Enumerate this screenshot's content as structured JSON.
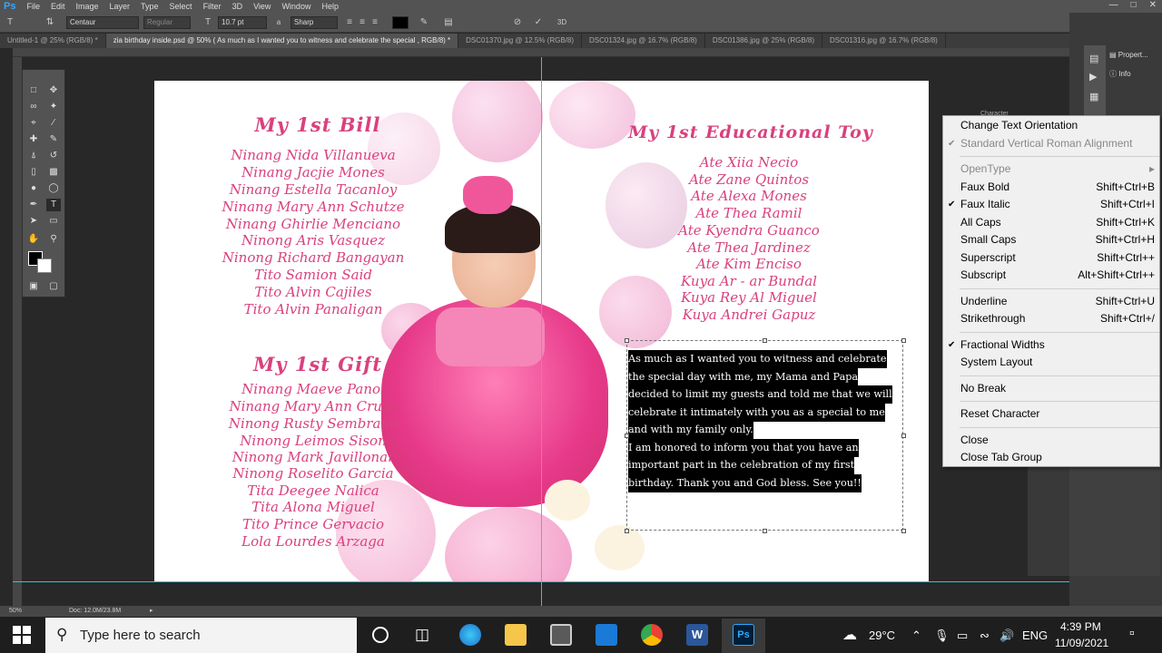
{
  "app": {
    "logo": "Ps",
    "menu": [
      "File",
      "Edit",
      "Image",
      "Layer",
      "Type",
      "Select",
      "Filter",
      "3D",
      "View",
      "Window",
      "Help"
    ]
  },
  "options": {
    "font_family": "Centaur",
    "font_style": "Regular",
    "font_size": "10.7 pt",
    "aa_label": "a",
    "anti_alias": "Sharp",
    "workspace": "3D"
  },
  "tabs": [
    {
      "label": "Untitled-1 @ 25% (RGB/8) *",
      "active": false
    },
    {
      "label": "zia birthday inside.psd @ 50% ( As much as I wanted you to witness and celebrate the special , RGB/8) *",
      "active": true
    },
    {
      "label": "DSC01370.jpg @ 12.5% (RGB/8)",
      "active": false
    },
    {
      "label": "DSC01324.jpg @ 16.7% (RGB/8)",
      "active": false
    },
    {
      "label": "DSC01386.jpg @ 25% (RGB/8)",
      "active": false
    },
    {
      "label": "DSC01316.jpg @ 16.7% (RGB/8)",
      "active": false
    }
  ],
  "document": {
    "bill_heading": "My 1st Bill",
    "bill_names": [
      "Ninang Nida Villanueva",
      "Ninang Jacjie Mones",
      "Ninang Estella Tacanloy",
      "Ninang Mary Ann Schutze",
      "Ninang Ghirlie Menciano",
      "Ninong Aris Vasquez",
      "Ninong Richard Bangayan",
      "Tito Samion Said",
      "Tito Alvin Cajiles",
      "Tito Alvin Panaligan"
    ],
    "gift_heading": "My 1st Gift",
    "gift_names": [
      "Ninang Maeve Panol",
      "Ninang Mary Ann Cruse",
      "Ninong Rusty Sembrano",
      "Ninong Leimos Sison",
      "Ninong Mark Javillonar",
      "Ninong Roselito Garcia",
      "Tita Deegee Nalica",
      "Tita Alona Miguel",
      "Tito Prince Gervacio",
      "Lola Lourdes Arzaga"
    ],
    "toy_heading": "My 1st Educational Toy",
    "toy_names": [
      "Ate Xiia Necio",
      "Ate Zane Quintos",
      "Ate Alexa Mones",
      "Ate Thea Ramil",
      "Ate Kyendra Guanco",
      "Ate Thea Jardinez",
      "Ate Kim Enciso",
      "Kuya Ar - ar Bundal",
      "Kuya Rey Al Miguel",
      "Kuya Andrei Gapuz"
    ],
    "message_lines": [
      "  As much as I wanted you to witness and celebrate",
      "the special day with me, my Mama and Papa",
      "decided to limit my guests and told me that we will",
      "celebrate it intimately with you as a special to me",
      "and with my family only.",
      "  I am honored to inform you that you have an",
      "important part in the celebration of my first",
      "birthday. Thank you and God bless. See you!!"
    ]
  },
  "panels": {
    "properties": "Propert...",
    "info": "Info",
    "character_tab": "Character"
  },
  "context_menu": {
    "items": [
      {
        "label": "Change Text Orientation",
        "shortcut": "",
        "checked": false,
        "disabled": false
      },
      {
        "label": "Standard Vertical Roman Alignment",
        "shortcut": "",
        "checked": true,
        "disabled": true
      },
      {
        "sep": true
      },
      {
        "label": "OpenType",
        "shortcut": "",
        "checked": false,
        "disabled": true,
        "submenu": true
      },
      {
        "label": "Faux Bold",
        "shortcut": "Shift+Ctrl+B",
        "checked": false,
        "disabled": false
      },
      {
        "label": "Faux Italic",
        "shortcut": "Shift+Ctrl+I",
        "checked": true,
        "disabled": false
      },
      {
        "label": "All Caps",
        "shortcut": "Shift+Ctrl+K",
        "checked": false,
        "disabled": false
      },
      {
        "label": "Small Caps",
        "shortcut": "Shift+Ctrl+H",
        "checked": false,
        "disabled": false
      },
      {
        "label": "Superscript",
        "shortcut": "Shift+Ctrl++",
        "checked": false,
        "disabled": false
      },
      {
        "label": "Subscript",
        "shortcut": "Alt+Shift+Ctrl++",
        "checked": false,
        "disabled": false
      },
      {
        "sep": true
      },
      {
        "label": "Underline",
        "shortcut": "Shift+Ctrl+U",
        "checked": false,
        "disabled": false
      },
      {
        "label": "Strikethrough",
        "shortcut": "Shift+Ctrl+/",
        "checked": false,
        "disabled": false
      },
      {
        "sep": true
      },
      {
        "label": "Fractional Widths",
        "shortcut": "",
        "checked": true,
        "disabled": false
      },
      {
        "label": "System Layout",
        "shortcut": "",
        "checked": false,
        "disabled": false
      },
      {
        "sep": true
      },
      {
        "label": "No Break",
        "shortcut": "",
        "checked": false,
        "disabled": false
      },
      {
        "sep": true
      },
      {
        "label": "Reset Character",
        "shortcut": "",
        "checked": false,
        "disabled": false
      },
      {
        "sep": true
      },
      {
        "label": "Close",
        "shortcut": "",
        "checked": false,
        "disabled": false
      },
      {
        "label": "Close Tab Group",
        "shortcut": "",
        "checked": false,
        "disabled": false
      }
    ]
  },
  "status": {
    "zoom": "50%",
    "doc": "Doc: 12.0M/23.8M"
  },
  "taskbar": {
    "search_placeholder": "Type here to search",
    "weather": "29°C",
    "lang": "ENG",
    "time": "4:39 PM",
    "date": "11/09/2021",
    "word_icon": "W",
    "ps_icon": "Ps"
  },
  "colors": {
    "accent": "#d9417e",
    "ps_blue": "#31a8ff"
  }
}
